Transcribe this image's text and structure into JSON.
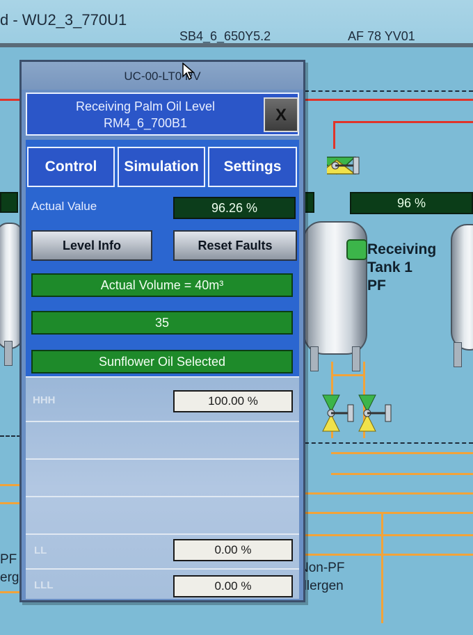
{
  "background": {
    "window_title": "d - WU2_3_770U1",
    "header_tag_left": "SB4_6_650Y5.2",
    "header_tag_right": "AF 78 YV01",
    "left_value": "",
    "right_value": "96 %",
    "tank_label_line1": "Receiving",
    "tank_label_line2": "Tank 1",
    "tank_label_line3": "PF",
    "left_label_1": "PF",
    "left_label_2": "erge",
    "nonpf_line1": "Non-PF",
    "nonpf_line2": "Allergen"
  },
  "faceplate": {
    "title": "UC-00-LT0 PV",
    "description_line1": "Receiving Palm Oil Level",
    "description_line2": "RM4_6_700B1",
    "close_label": "X",
    "tabs": [
      {
        "label": "Control"
      },
      {
        "label": "Simulation"
      },
      {
        "label": "Settings"
      }
    ],
    "actual_value_label": "Actual Value",
    "actual_value": "96.26 %",
    "level_info_label": "Level Info",
    "reset_faults_label": "Reset Faults",
    "actual_volume": "Actual Volume = 40m³",
    "count_value": "35",
    "product_selected": "Sunflower Oil Selected",
    "limits": [
      {
        "label": "HHH",
        "value": "100.00 %"
      },
      {
        "label": "LL",
        "value": "0.00 %"
      },
      {
        "label": "LLL",
        "value": "0.00 %"
      }
    ]
  },
  "colors": {
    "faceplate_blue": "#2b66d0",
    "value_green": "#0c3d1b",
    "status_green": "#1e8a2a",
    "alarm_red": "#e0342a",
    "pipe_orange": "#f2a33a"
  }
}
